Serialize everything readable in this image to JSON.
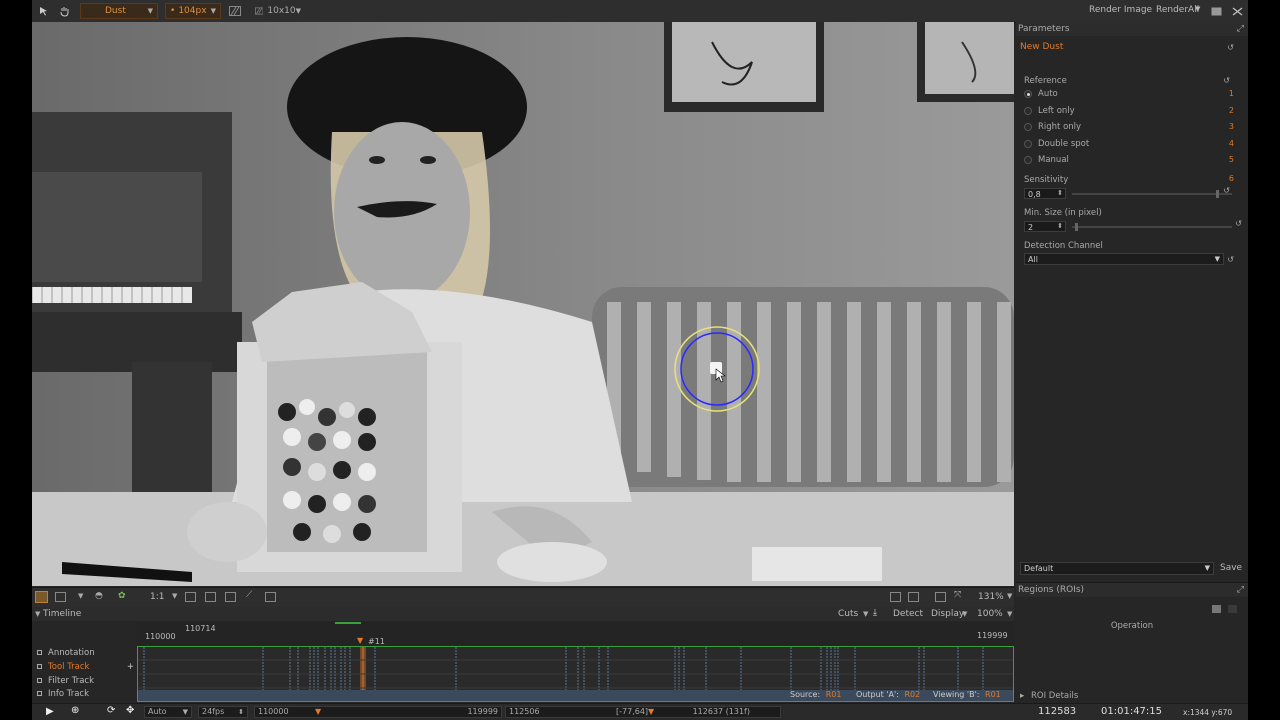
{
  "toolbar": {
    "tool_preset": "Dust",
    "brush_size": "104px",
    "grid": "10x10",
    "render_image": "Render Image",
    "render_all": "RenderAll"
  },
  "parameters": {
    "panel_title": "Parameters",
    "effect_name": "New Dust",
    "reference_label": "Reference",
    "reference_options": [
      {
        "label": "Auto",
        "key": "1",
        "selected": true
      },
      {
        "label": "Left only",
        "key": "2",
        "selected": false
      },
      {
        "label": "Right only",
        "key": "3",
        "selected": false
      },
      {
        "label": "Double spot",
        "key": "4",
        "selected": false
      },
      {
        "label": "Manual",
        "key": "5",
        "selected": false
      }
    ],
    "sensitivity_label": "Sensitivity",
    "sensitivity_key": "6",
    "sensitivity_value": "0,8",
    "sensitivity_level": 0.9,
    "min_size_label": "Min. Size (in pixel)",
    "min_size_value": "2",
    "min_size_level": 0.02,
    "detection_channel_label": "Detection Channel",
    "detection_channel_value": "All",
    "preset_value": "Default",
    "save_label": "Save"
  },
  "regions": {
    "title": "Regions (ROIs)",
    "operation_header": "Operation",
    "details_label": "ROI Details"
  },
  "viewer_toolbar": {
    "zoom_ratio": "1:1",
    "zoom_percent": "131%"
  },
  "timeline": {
    "title": "Timeline",
    "cuts_label": "Cuts",
    "detect_label": "Detect",
    "display_label": "Display",
    "zoom": "100%",
    "range_start": "110000",
    "marker_frame": "110714",
    "range_end": "119999",
    "playhead_label": "#11",
    "tracks": [
      "Annotation",
      "Tool Track",
      "Filter Track",
      "Info Track"
    ],
    "source_label": "Source:",
    "source_value": "R01",
    "output_label": "Output 'A':",
    "output_value": "R02",
    "viewing_label": "Viewing 'B':",
    "viewing_value": "R01"
  },
  "bottom_bar": {
    "mode": "Auto",
    "fps": "24fps",
    "start_frame": "110000",
    "end_frame": "119999",
    "in_frame": "112506",
    "offset": "[-77,64]",
    "out_frame": "112637 (131f)",
    "current_frame": "112583",
    "timecode": "01:01:47:15",
    "cursor_pos": "x:1344 y:670"
  },
  "colors": {
    "accent": "#e07a2a",
    "timeline_green": "#3aa03a",
    "brush_outer": "#e8e27a",
    "brush_inner": "#2a2aff"
  }
}
